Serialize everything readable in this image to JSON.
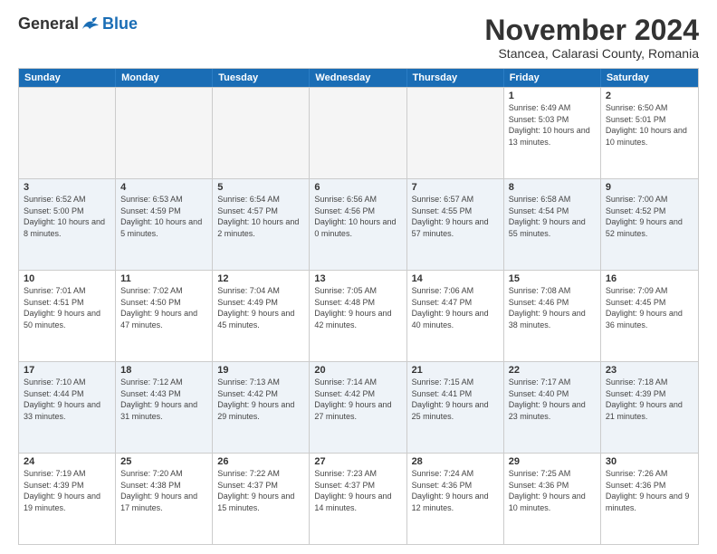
{
  "logo": {
    "general": "General",
    "blue": "Blue"
  },
  "title": "November 2024",
  "subtitle": "Stancea, Calarasi County, Romania",
  "headers": [
    "Sunday",
    "Monday",
    "Tuesday",
    "Wednesday",
    "Thursday",
    "Friday",
    "Saturday"
  ],
  "rows": [
    [
      {
        "day": "",
        "info": ""
      },
      {
        "day": "",
        "info": ""
      },
      {
        "day": "",
        "info": ""
      },
      {
        "day": "",
        "info": ""
      },
      {
        "day": "",
        "info": ""
      },
      {
        "day": "1",
        "info": "Sunrise: 6:49 AM\nSunset: 5:03 PM\nDaylight: 10 hours and 13 minutes."
      },
      {
        "day": "2",
        "info": "Sunrise: 6:50 AM\nSunset: 5:01 PM\nDaylight: 10 hours and 10 minutes."
      }
    ],
    [
      {
        "day": "3",
        "info": "Sunrise: 6:52 AM\nSunset: 5:00 PM\nDaylight: 10 hours and 8 minutes."
      },
      {
        "day": "4",
        "info": "Sunrise: 6:53 AM\nSunset: 4:59 PM\nDaylight: 10 hours and 5 minutes."
      },
      {
        "day": "5",
        "info": "Sunrise: 6:54 AM\nSunset: 4:57 PM\nDaylight: 10 hours and 2 minutes."
      },
      {
        "day": "6",
        "info": "Sunrise: 6:56 AM\nSunset: 4:56 PM\nDaylight: 10 hours and 0 minutes."
      },
      {
        "day": "7",
        "info": "Sunrise: 6:57 AM\nSunset: 4:55 PM\nDaylight: 9 hours and 57 minutes."
      },
      {
        "day": "8",
        "info": "Sunrise: 6:58 AM\nSunset: 4:54 PM\nDaylight: 9 hours and 55 minutes."
      },
      {
        "day": "9",
        "info": "Sunrise: 7:00 AM\nSunset: 4:52 PM\nDaylight: 9 hours and 52 minutes."
      }
    ],
    [
      {
        "day": "10",
        "info": "Sunrise: 7:01 AM\nSunset: 4:51 PM\nDaylight: 9 hours and 50 minutes."
      },
      {
        "day": "11",
        "info": "Sunrise: 7:02 AM\nSunset: 4:50 PM\nDaylight: 9 hours and 47 minutes."
      },
      {
        "day": "12",
        "info": "Sunrise: 7:04 AM\nSunset: 4:49 PM\nDaylight: 9 hours and 45 minutes."
      },
      {
        "day": "13",
        "info": "Sunrise: 7:05 AM\nSunset: 4:48 PM\nDaylight: 9 hours and 42 minutes."
      },
      {
        "day": "14",
        "info": "Sunrise: 7:06 AM\nSunset: 4:47 PM\nDaylight: 9 hours and 40 minutes."
      },
      {
        "day": "15",
        "info": "Sunrise: 7:08 AM\nSunset: 4:46 PM\nDaylight: 9 hours and 38 minutes."
      },
      {
        "day": "16",
        "info": "Sunrise: 7:09 AM\nSunset: 4:45 PM\nDaylight: 9 hours and 36 minutes."
      }
    ],
    [
      {
        "day": "17",
        "info": "Sunrise: 7:10 AM\nSunset: 4:44 PM\nDaylight: 9 hours and 33 minutes."
      },
      {
        "day": "18",
        "info": "Sunrise: 7:12 AM\nSunset: 4:43 PM\nDaylight: 9 hours and 31 minutes."
      },
      {
        "day": "19",
        "info": "Sunrise: 7:13 AM\nSunset: 4:42 PM\nDaylight: 9 hours and 29 minutes."
      },
      {
        "day": "20",
        "info": "Sunrise: 7:14 AM\nSunset: 4:42 PM\nDaylight: 9 hours and 27 minutes."
      },
      {
        "day": "21",
        "info": "Sunrise: 7:15 AM\nSunset: 4:41 PM\nDaylight: 9 hours and 25 minutes."
      },
      {
        "day": "22",
        "info": "Sunrise: 7:17 AM\nSunset: 4:40 PM\nDaylight: 9 hours and 23 minutes."
      },
      {
        "day": "23",
        "info": "Sunrise: 7:18 AM\nSunset: 4:39 PM\nDaylight: 9 hours and 21 minutes."
      }
    ],
    [
      {
        "day": "24",
        "info": "Sunrise: 7:19 AM\nSunset: 4:39 PM\nDaylight: 9 hours and 19 minutes."
      },
      {
        "day": "25",
        "info": "Sunrise: 7:20 AM\nSunset: 4:38 PM\nDaylight: 9 hours and 17 minutes."
      },
      {
        "day": "26",
        "info": "Sunrise: 7:22 AM\nSunset: 4:37 PM\nDaylight: 9 hours and 15 minutes."
      },
      {
        "day": "27",
        "info": "Sunrise: 7:23 AM\nSunset: 4:37 PM\nDaylight: 9 hours and 14 minutes."
      },
      {
        "day": "28",
        "info": "Sunrise: 7:24 AM\nSunset: 4:36 PM\nDaylight: 9 hours and 12 minutes."
      },
      {
        "day": "29",
        "info": "Sunrise: 7:25 AM\nSunset: 4:36 PM\nDaylight: 9 hours and 10 minutes."
      },
      {
        "day": "30",
        "info": "Sunrise: 7:26 AM\nSunset: 4:36 PM\nDaylight: 9 hours and 9 minutes."
      }
    ]
  ]
}
